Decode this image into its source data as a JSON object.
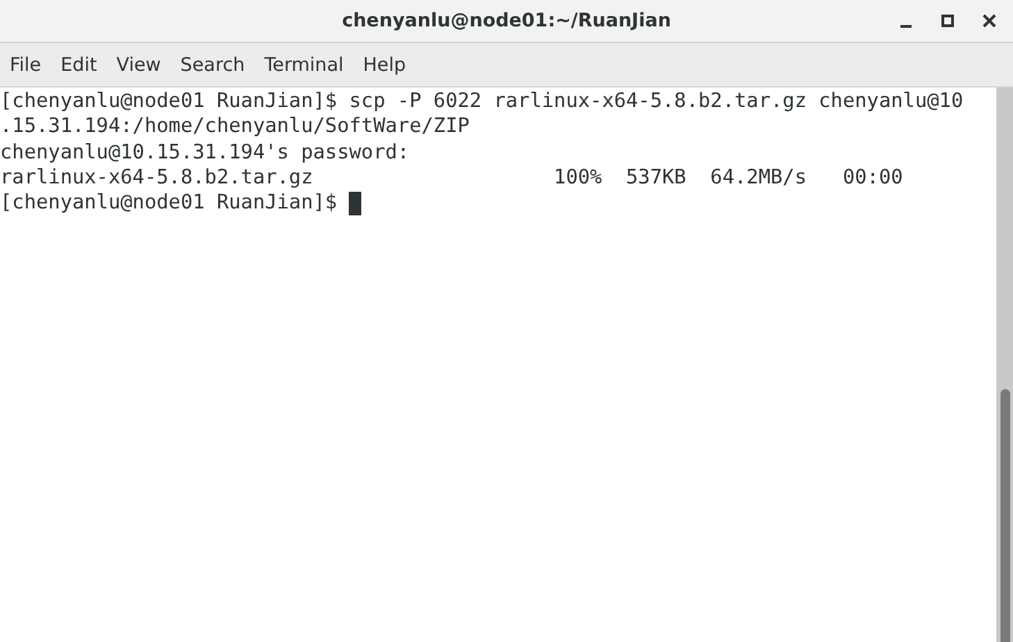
{
  "window": {
    "title": "chenyanlu@node01:~/RuanJian"
  },
  "menu": [
    "File",
    "Edit",
    "View",
    "Search",
    "Terminal",
    "Help"
  ],
  "terminal": {
    "lines": [
      "[chenyanlu@node01 RuanJian]$ scp -P 6022 rarlinux-x64-5.8.b2.tar.gz chenyanlu@10",
      ".15.31.194:/home/chenyanlu/SoftWare/ZIP",
      "chenyanlu@10.15.31.194's password:",
      "rarlinux-x64-5.8.b2.tar.gz                    100%  537KB  64.2MB/s   00:00",
      "[chenyanlu@node01 RuanJian]$ "
    ],
    "cursor_visible": true
  }
}
